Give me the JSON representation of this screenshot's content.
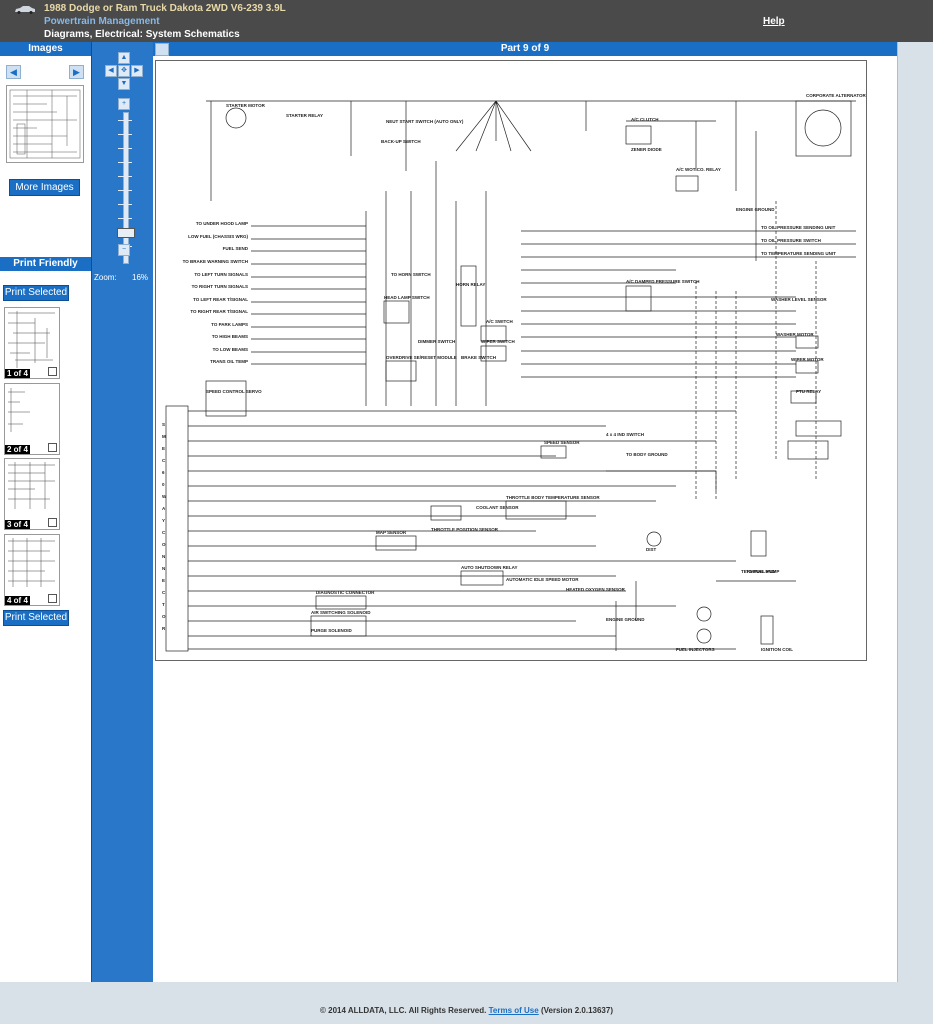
{
  "header": {
    "vehicle": "1988 Dodge or Ram Truck Dakota 2WD V6-239 3.9L",
    "section": "Powertrain Management",
    "subsection": "Diagrams, Electrical: System Schematics",
    "help_label": "Help"
  },
  "images_panel": {
    "title": "Images",
    "more_images_label": "More Images"
  },
  "print_panel": {
    "title": "Print Friendly",
    "print_selected_label": "Print Selected",
    "thumbnails": [
      {
        "label": "1 of 4"
      },
      {
        "label": "2 of 4"
      },
      {
        "label": "3 of 4"
      },
      {
        "label": "4 of 4"
      }
    ]
  },
  "zoom": {
    "label": "Zoom:",
    "value": "16%"
  },
  "viewer": {
    "part_label": "Part 9 of 9"
  },
  "schematic": {
    "top_labels": [
      "STARTER MOTOR",
      "STARTER RELAY",
      "NEUT START SWITCH (AUTO ONLY)",
      "BACK-UP SWITCH",
      "A/C CLUTCH",
      "ZENER DIODE",
      "CORPORATE ALTERNATOR",
      "A/C WOT CO. RELAY",
      "ENGINE GROUND"
    ],
    "left_labels": [
      "TO UNDER HOOD LAMP",
      "LOW FUEL (CHASSIS WRG)",
      "FUEL SEND",
      "TO BRAKE WARNING SWITCH",
      "TO LEFT TURN SIGNALS",
      "TO RIGHT TURN SIGNALS",
      "TO LEFT REAR T/SIGNAL",
      "TO RIGHT REAR T/SIGNAL",
      "TO PARK LAMPS",
      "TO HIGH BEAMS",
      "TO LOW BEAMS",
      "TRANS OIL TEMP"
    ],
    "right_labels": [
      "TO OIL PRESSURE SENDING UNIT",
      "TO OIL PRESSURE SWITCH",
      "TO TEMPERATURE SENDING UNIT",
      "WASHER LEVEL SENSOR",
      "WASHER MOTOR",
      "WIPER MOTOR",
      "PTU RELAY"
    ],
    "mid_labels": [
      "HORN RELAY",
      "HEAD LAMP SWITCH",
      "DIMMER SWITCH",
      "A/C SWITCH",
      "WIPER SWITCH",
      "BRAKE SWITCH",
      "OVERDRIVE SE/RESET MODULE",
      "SPEED CONTROL SERVO",
      "A/C DAMPED PRESSURE SWITCH",
      "TO HORN SWITCH"
    ],
    "lower_labels": [
      "SPEED SENSOR",
      "THROTTLE BODY TEMPERATURE SENSOR",
      "COOLANT SENSOR",
      "MAP SENSOR",
      "THROTTLE POSITION SENSOR",
      "DIAGNOSTIC CONNECTOR",
      "AUTO SHUTDOWN RELAY",
      "AIR SWITCHING SOLENOID",
      "PURGE SOLENOID",
      "AUTOMATIC IDLE SPEED MOTOR",
      "HEATED OXYGEN SENSOR",
      "ENGINE GROUND",
      "FUEL INJECTORS",
      "IGNITION COIL",
      "TERMINAL END",
      "TO FUEL PUMP",
      "DIST",
      "TO BODY GROUND",
      "4 x 4 IND SWITCH"
    ],
    "connector_label": "SMEC 60 WAY CONNECTOR"
  },
  "footer": {
    "copyright": "© 2014 ALLDATA, LLC. All Rights Reserved.",
    "terms_label": "Terms of Use",
    "version": "(Version 2.0.13637)"
  }
}
